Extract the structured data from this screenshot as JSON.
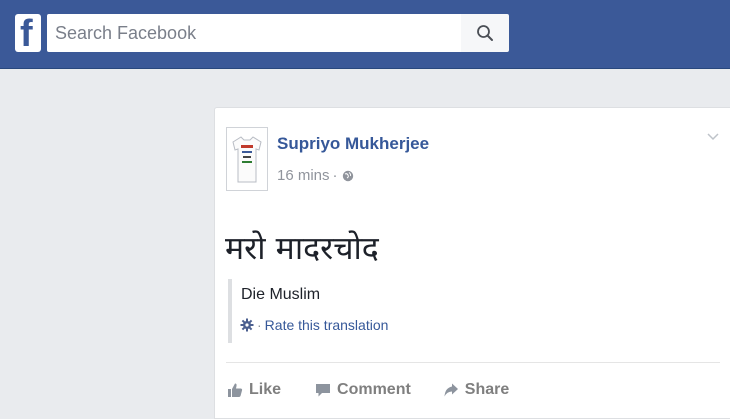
{
  "header": {
    "logo_letter": "f",
    "search_placeholder": "Search Facebook"
  },
  "post": {
    "author": "Supriyo Mukherjee",
    "time": "16 mins",
    "separator": "·",
    "text": "मरो मादरचोद",
    "translation": "Die Muslim",
    "rate_separator": "·",
    "rate_link": "Rate this translation",
    "actions": {
      "like": "Like",
      "comment": "Comment",
      "share": "Share"
    }
  },
  "colors": {
    "brand": "#3b5998",
    "link": "#365899",
    "background": "#e9ebee"
  }
}
